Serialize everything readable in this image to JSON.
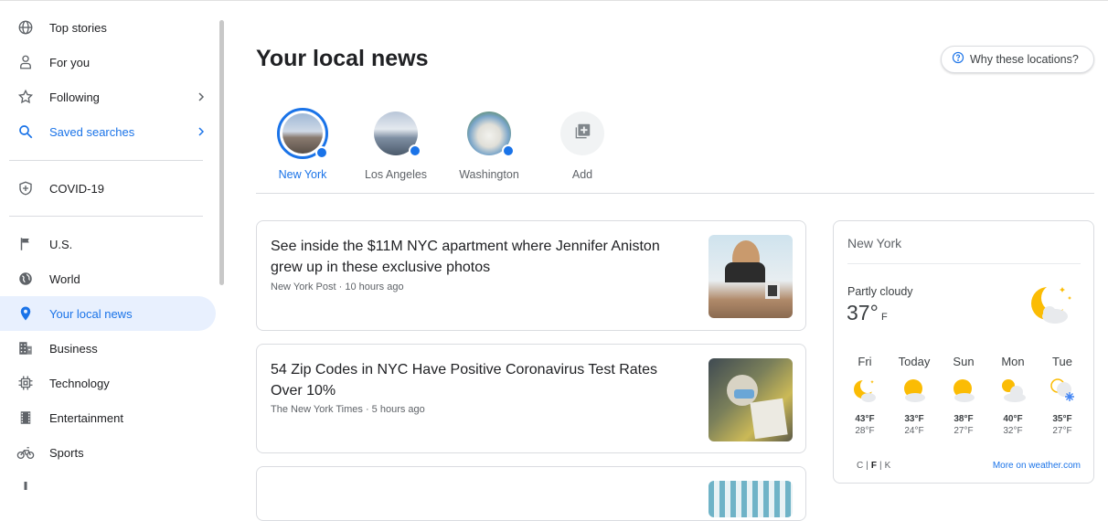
{
  "sidebar": {
    "items": [
      {
        "label": "Top stories",
        "icon": "globe-icon"
      },
      {
        "label": "For you",
        "icon": "person-icon"
      },
      {
        "label": "Following",
        "icon": "star-icon"
      },
      {
        "label": "Saved searches",
        "icon": "search-icon"
      },
      {
        "label": "COVID-19",
        "icon": "shield-icon"
      },
      {
        "label": "U.S.",
        "icon": "flag-icon"
      },
      {
        "label": "World",
        "icon": "world-icon"
      },
      {
        "label": "Your local news",
        "icon": "location-pin-icon"
      },
      {
        "label": "Business",
        "icon": "building-icon"
      },
      {
        "label": "Technology",
        "icon": "chip-icon"
      },
      {
        "label": "Entertainment",
        "icon": "film-icon"
      },
      {
        "label": "Sports",
        "icon": "bike-icon"
      }
    ]
  },
  "main": {
    "title": "Your local news",
    "why_button": "Why these locations?",
    "locations": [
      {
        "label": "New York",
        "selected": true
      },
      {
        "label": "Los Angeles"
      },
      {
        "label": "Washington"
      },
      {
        "label": "Add"
      }
    ],
    "articles": [
      {
        "headline": "See inside the $11M NYC apartment where Jennifer Aniston grew up in these exclusive photos",
        "source": "New York Post",
        "time": "10 hours ago"
      },
      {
        "headline": "54 Zip Codes in NYC Have Positive Coronavirus Test Rates Over 10%",
        "source": "The New York Times",
        "time": "5 hours ago"
      }
    ]
  },
  "weather": {
    "city": "New York",
    "condition": "Partly cloudy",
    "temp": "37°",
    "unit": "F",
    "days": [
      {
        "name": "Fri",
        "hi": "43°F",
        "lo": "28°F",
        "icon": "moon-cloud-icon"
      },
      {
        "name": "Today",
        "hi": "33°F",
        "lo": "24°F",
        "icon": "sun-cloud-icon"
      },
      {
        "name": "Sun",
        "hi": "38°F",
        "lo": "27°F",
        "icon": "sun-cloud-icon"
      },
      {
        "name": "Mon",
        "hi": "40°F",
        "lo": "32°F",
        "icon": "cloudy-icon"
      },
      {
        "name": "Tue",
        "hi": "35°F",
        "lo": "27°F",
        "icon": "snow-icon"
      }
    ],
    "units": [
      "C",
      "F",
      "K"
    ],
    "more_link": "More on weather.com"
  },
  "colors": {
    "accent": "#1a73e8",
    "active_bg": "#e8f0fe",
    "sun": "#fbbc04"
  }
}
